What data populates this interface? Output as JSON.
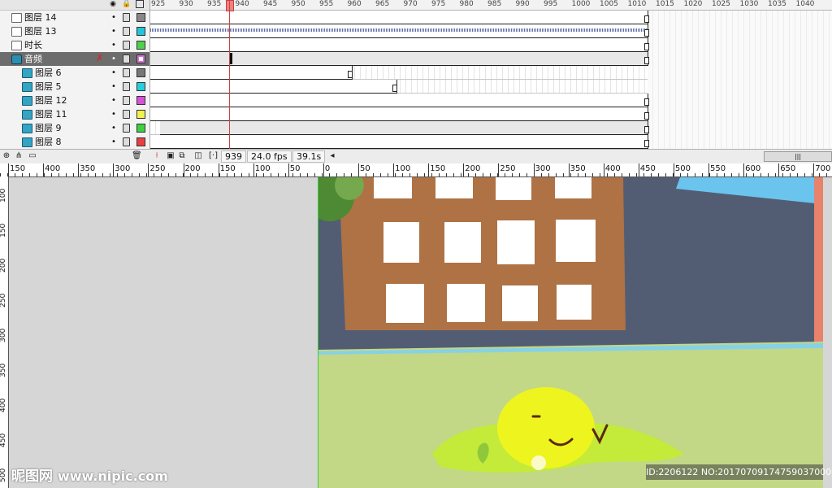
{
  "timeline": {
    "header_icons": [
      "eye-icon",
      "lock-icon",
      "outline-icon"
    ],
    "layers": [
      {
        "name": "图层 14",
        "type": "normal",
        "color": "#888888"
      },
      {
        "name": "图层 13",
        "type": "normal",
        "color": "#22c4d8"
      },
      {
        "name": "时长",
        "type": "normal",
        "color": "#4fd04f"
      },
      {
        "name": "音频",
        "type": "audio",
        "color": "#d86fd8",
        "selected": true
      },
      {
        "name": "图层 6",
        "type": "clip",
        "color": "#777777"
      },
      {
        "name": "图层 5",
        "type": "clip",
        "color": "#22d0e0"
      },
      {
        "name": "图层 12",
        "type": "clip",
        "color": "#d84fd8"
      },
      {
        "name": "图层 11",
        "type": "clip",
        "color": "#f2f24a"
      },
      {
        "name": "图层 9",
        "type": "clip",
        "color": "#3fd03f"
      },
      {
        "name": "图层 8",
        "type": "clip",
        "color": "#e84040"
      }
    ],
    "frame_ruler": [
      "925",
      "930",
      "935",
      "940",
      "945",
      "950",
      "955",
      "960",
      "965",
      "970",
      "975",
      "980",
      "985",
      "990",
      "995",
      "1000",
      "1005",
      "1010",
      "1015",
      "1020",
      "1025",
      "1030",
      "1035",
      "1040"
    ],
    "current_frame": "939",
    "fps": "24.0 fps",
    "elapsed": "39.1s",
    "scroll_arrow": "◂",
    "scroll_grip": "|||"
  },
  "stage_ruler": {
    "horizontal": [
      "150",
      "400",
      "350",
      "300",
      "250",
      "200",
      "150",
      "100",
      "50",
      "0",
      "50",
      "100",
      "150",
      "200",
      "250",
      "300",
      "350",
      "400",
      "450",
      "500",
      "550",
      "600",
      "650",
      "700"
    ],
    "vertical": [
      "100",
      "150",
      "200",
      "250",
      "300",
      "350",
      "400",
      "450",
      "500"
    ]
  },
  "scene": {
    "sky_color": "#525d74",
    "building_color": "#ae7245",
    "grass_color": "#c2d886",
    "character_color": "#eef41e"
  },
  "watermark": {
    "site": "昵图网",
    "url": "www.nipic.com",
    "id_text": "ID:2206122 NO:20170709174759037000"
  }
}
